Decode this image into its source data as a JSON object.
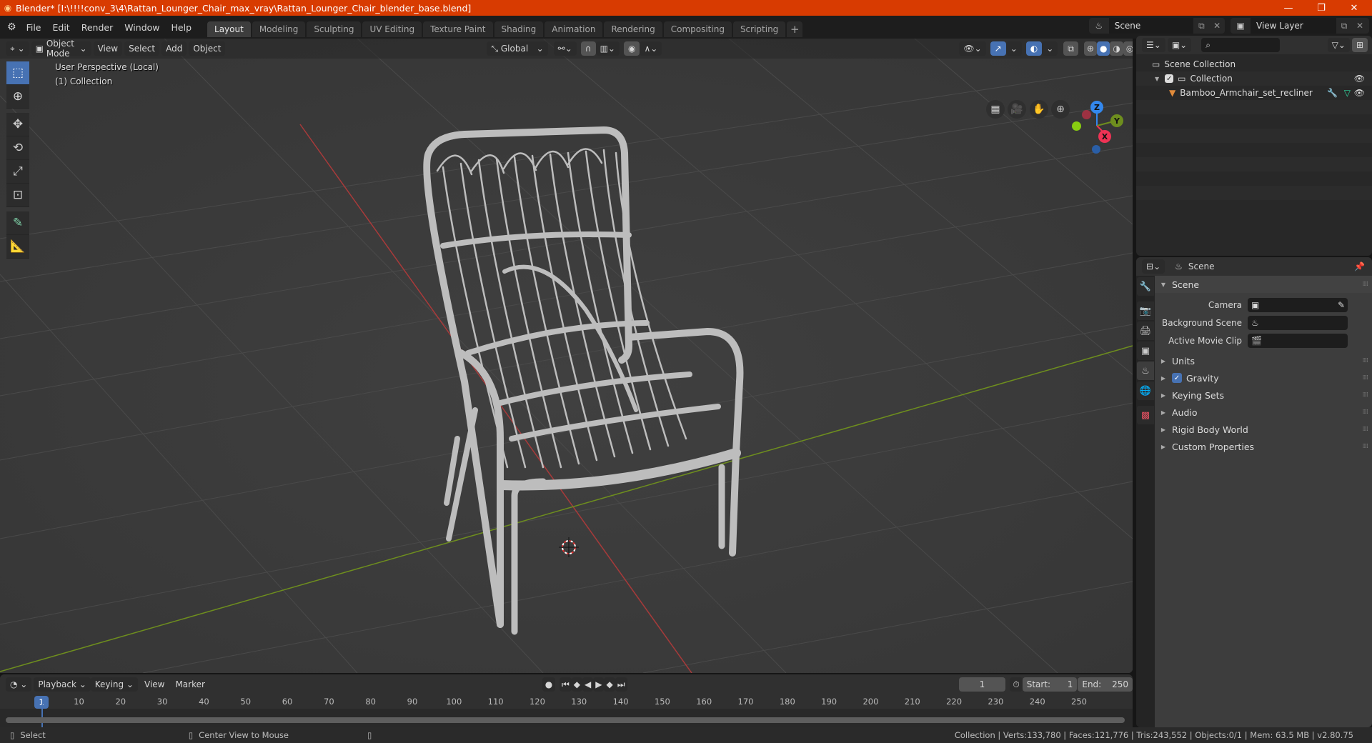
{
  "window": {
    "title": "Blender* [I:\\!!!!conv_3\\4\\Rattan_Lounger_Chair_max_vray\\Rattan_Lounger_Chair_blender_base.blend]",
    "minimize_icon": "minimize-icon",
    "maximize_icon": "restore-icon",
    "close_icon": "close-icon"
  },
  "menu": [
    "File",
    "Edit",
    "Render",
    "Window",
    "Help"
  ],
  "workspaces": {
    "tabs": [
      "Layout",
      "Modeling",
      "Sculpting",
      "UV Editing",
      "Texture Paint",
      "Shading",
      "Animation",
      "Rendering",
      "Compositing",
      "Scripting"
    ],
    "active": "Layout",
    "add_label": "+"
  },
  "scene_selector": {
    "value": "Scene"
  },
  "view_layer_selector": {
    "value": "View Layer"
  },
  "viewport": {
    "mode": "Object Mode",
    "menus": [
      "View",
      "Select",
      "Add",
      "Object"
    ],
    "orientation": "Global",
    "info_line1": "User Perspective (Local)",
    "info_line2": "(1) Collection",
    "gizmo_axes": {
      "x": "X",
      "y": "Y",
      "z": "Z"
    },
    "colors": {
      "x_axis": "#a83a3a",
      "y_axis": "#6e8e1e",
      "x_bubble": "#ee3355",
      "y_bubble": "#88bb22",
      "z_bubble": "#3388ee",
      "active_blue": "#4772b3"
    },
    "tools": [
      "select-box",
      "cursor",
      "move",
      "rotate",
      "scale",
      "transform",
      "annotate",
      "measure"
    ]
  },
  "timeline": {
    "menus": [
      "Playback",
      "Keying",
      "View",
      "Marker"
    ],
    "current_frame": "1",
    "start_label": "Start:",
    "start": "1",
    "end_label": "End:",
    "end": "250",
    "ruler_ticks": [
      "10",
      "20",
      "30",
      "40",
      "50",
      "60",
      "70",
      "80",
      "90",
      "100",
      "110",
      "120",
      "130",
      "140",
      "150",
      "160",
      "170",
      "180",
      "190",
      "200",
      "210",
      "220",
      "230",
      "240",
      "250"
    ]
  },
  "statusbar": {
    "left_action": "Select",
    "middle_action": "Center View to Mouse",
    "stats": "Collection | Verts:133,780 | Faces:121,776 | Tris:243,552 | Objects:0/1 | Mem: 63.5 MB | v2.80.75"
  },
  "outliner": {
    "scene_collection": "Scene Collection",
    "collection": "Collection",
    "object": "Bamboo_Armchair_set_recliner"
  },
  "properties": {
    "context": "Scene",
    "panel_title": "Scene",
    "fields": [
      {
        "label": "Camera",
        "value": ""
      },
      {
        "label": "Background Scene",
        "value": ""
      },
      {
        "label": "Active Movie Clip",
        "value": ""
      }
    ],
    "sections": [
      {
        "label": "Units",
        "checkbox": false
      },
      {
        "label": "Gravity",
        "checkbox": true
      },
      {
        "label": "Keying Sets",
        "checkbox": false
      },
      {
        "label": "Audio",
        "checkbox": false
      },
      {
        "label": "Rigid Body World",
        "checkbox": false
      },
      {
        "label": "Custom Properties",
        "checkbox": false
      }
    ]
  }
}
